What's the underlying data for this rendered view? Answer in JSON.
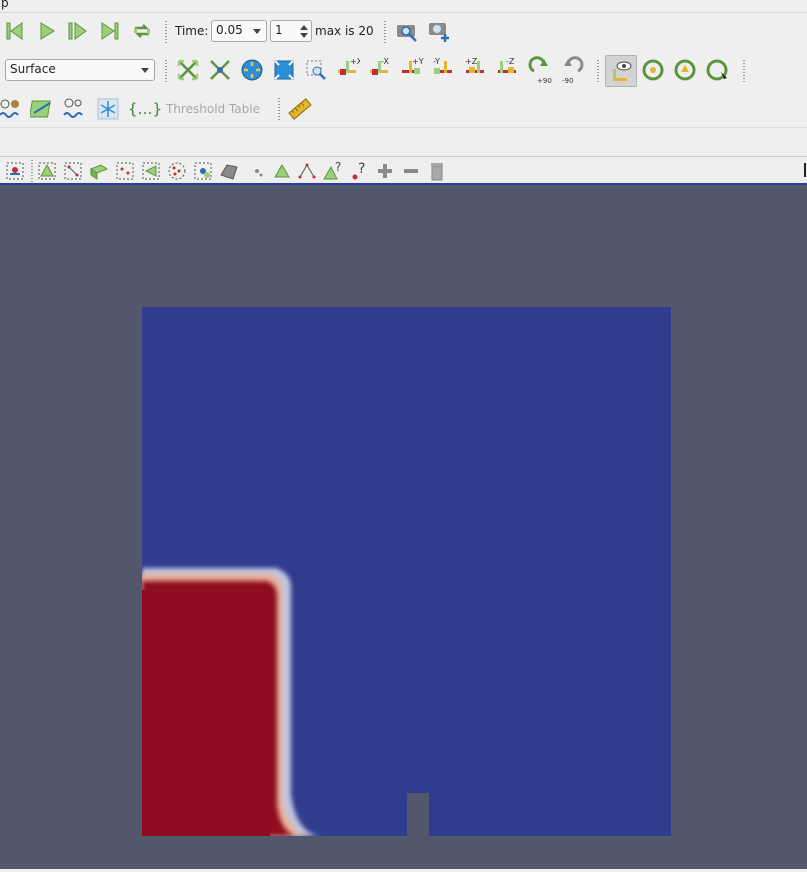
{
  "menubar": {
    "partial_label": "p"
  },
  "vcr": {
    "time_label": "Time:",
    "time_value": "0.05",
    "timestep_value": "1",
    "max_label": "max is 20"
  },
  "representation": {
    "selected": "Surface"
  },
  "filters": {
    "threshold_table_label": "Threshold Table"
  },
  "camera": {
    "plus_x": "+X",
    "minus_x": "-X",
    "plus_y": "+Y",
    "minus_y": "-Y",
    "plus_z": "+Z",
    "minus_z": "-Z",
    "rot_plus": "+90",
    "rot_minus": "-90"
  },
  "colors": {
    "viewport_background": "#52576b",
    "field_low": "#303d8f",
    "field_high": "#8f0b1f"
  }
}
